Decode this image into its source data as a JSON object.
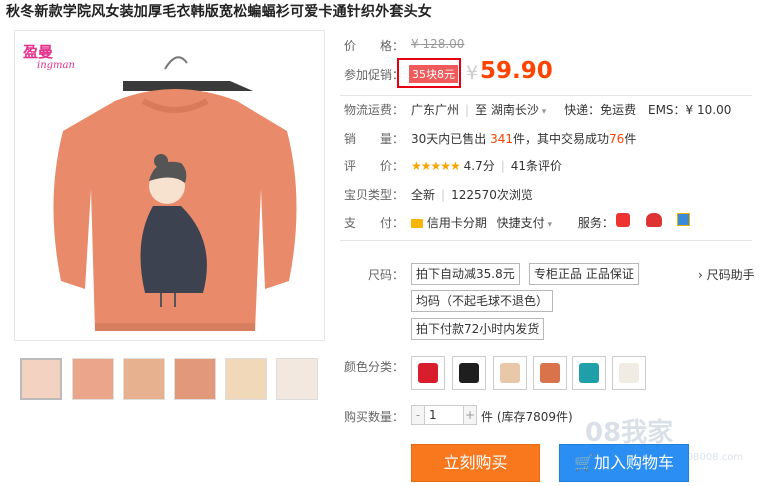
{
  "product": {
    "title": "秋冬新款学院风女装加厚毛衣韩版宽松蝙蝠衫可爱卡通针织外套头女"
  },
  "brand": {
    "logo_cn": "盈曼",
    "logo_en": "ingman"
  },
  "price": {
    "label": "价　　格：",
    "original": "¥ 128.00",
    "promo_label": "参加促销：",
    "promo_tag": "35块8元",
    "currency": "¥",
    "current": "59.90"
  },
  "shipping": {
    "label": "物流运费：",
    "from": "广东广州",
    "to_prefix": "至",
    "to": "湖南长沙",
    "method": "快递：免运费",
    "ems": "EMS：¥ 10.00"
  },
  "sales": {
    "label": "销　　量：",
    "prefix": "30天内已售出",
    "sold": "341",
    "mid": "件，其中交易成功",
    "success": "76",
    "suffix": "件"
  },
  "rating": {
    "label": "评　　价：",
    "stars": "★★★★★",
    "score": "4.7分",
    "reviews": "41条评价"
  },
  "type": {
    "label": "宝贝类型：",
    "condition": "全新",
    "views": "122570次浏览"
  },
  "payment": {
    "label": "支　　付：",
    "credit": "信用卡分期",
    "quick": "快捷支付",
    "service_label": "服务："
  },
  "size": {
    "label": "尺码：",
    "options": [
      "拍下自动减35.8元",
      "专柜正品 正品保证",
      "均码（不起毛球不退色）",
      "拍下付款72小时内发货"
    ],
    "helper": "› 尺码助手"
  },
  "colors": {
    "label": "颜色分类：",
    "swatches": [
      "#d81e2c",
      "#1e1e1e",
      "#e8c8a8",
      "#d8734b",
      "#1fa0a8",
      "#f0ebe3"
    ]
  },
  "quantity": {
    "label": "购买数量：",
    "value": "1",
    "stock": "件 (库存7809件)"
  },
  "buttons": {
    "buy": "立刻购买",
    "cart": "加入购物车"
  },
  "watermark": {
    "text": "08我家",
    "url": "www.08008.com"
  }
}
